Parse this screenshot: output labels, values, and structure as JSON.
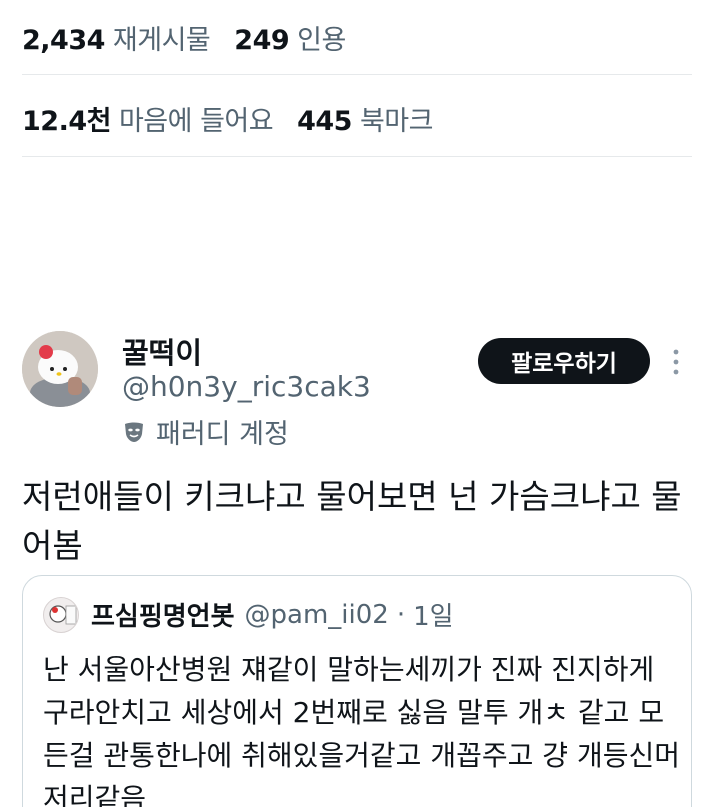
{
  "stats": {
    "reposts_count": "2,434",
    "reposts_label": "재게시물",
    "quotes_count": "249",
    "quotes_label": "인용",
    "likes_count": "12.4천",
    "likes_label": "마음에 들어요",
    "bookmarks_count": "445",
    "bookmarks_label": "북마크"
  },
  "author": {
    "display_name": "꿀떡이",
    "handle": "@h0n3y_ric3cak3",
    "badge_label": "패러디 계정",
    "follow_label": "팔로우하기"
  },
  "tweet": {
    "text": "저런애들이 키크냐고 물어보면 넌 가슴크냐고 물어봄"
  },
  "quoted": {
    "display_name": "프심핑명언봇",
    "handle": "@pam_ii02",
    "separator": "·",
    "time": "1일",
    "text": "난 서울아산병원 쟤같이 말하는세끼가 진짜 진지하게 구라안치고 세상에서 2번째로 싫음 말투 개ㅊ 같고 모든걸 관통한나에 취해있을거같고 개꼽주고 걍 개등신머저리같음"
  },
  "icons": {
    "more": "more-vertical-icon",
    "parody": "theater-mask-icon"
  }
}
